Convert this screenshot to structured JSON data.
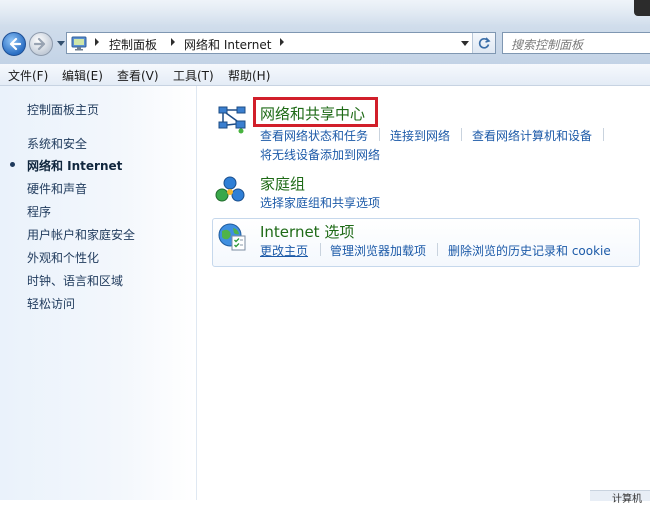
{
  "address_bar": {
    "breadcrumbs": [
      "控制面板",
      "网络和 Internet"
    ],
    "icon": "control-panel-icon"
  },
  "search": {
    "placeholder": "搜索控制面板"
  },
  "menu": {
    "items": [
      "文件(F)",
      "编辑(E)",
      "查看(V)",
      "工具(T)",
      "帮助(H)"
    ]
  },
  "sidebar": {
    "items": [
      {
        "label": "控制面板主页",
        "current": false
      },
      {
        "label": "系统和安全",
        "current": false
      },
      {
        "label": "网络和 Internet",
        "current": true
      },
      {
        "label": "硬件和声音",
        "current": false
      },
      {
        "label": "程序",
        "current": false
      },
      {
        "label": "用户帐户和家庭安全",
        "current": false
      },
      {
        "label": "外观和个性化",
        "current": false
      },
      {
        "label": "时钟、语言和区域",
        "current": false
      },
      {
        "label": "轻松访问",
        "current": false
      }
    ]
  },
  "categories": [
    {
      "title": "网络和共享中心",
      "icon": "network-icon",
      "highlighted": true,
      "links": [
        "查看网络状态和任务",
        "连接到网络",
        "查看网络计算机和设备",
        "将无线设备添加到网络"
      ]
    },
    {
      "title": "家庭组",
      "icon": "homegroup-icon",
      "highlighted": false,
      "links": [
        "选择家庭组和共享选项"
      ]
    },
    {
      "title": "Internet 选项",
      "icon": "internet-options-icon",
      "highlighted": false,
      "links": [
        "更改主页",
        "管理浏览器加载项",
        "删除浏览的历史记录和 cookie"
      ]
    }
  ],
  "status_bar": {
    "text": "计算机"
  },
  "colors": {
    "category_title": "#1e6a16",
    "link": "#1c5aa8",
    "highlight_border": "#d11f2a",
    "sidebar_text": "#1f3a5c"
  }
}
